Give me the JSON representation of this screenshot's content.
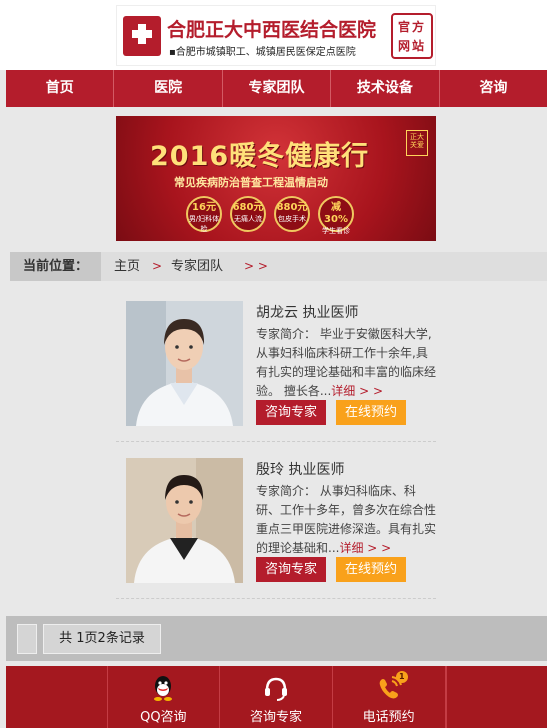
{
  "header": {
    "hospital_name": "合肥正大中西医结合医院",
    "tagline": "▪合肥市城镇职工、城镇居民医保定点医院",
    "badge_line1": "官方",
    "badge_line2": "网站"
  },
  "nav": {
    "items": [
      {
        "label": "首页"
      },
      {
        "label": "医院"
      },
      {
        "label": "专家团队"
      },
      {
        "label": "技术设备"
      },
      {
        "label": "咨询"
      }
    ]
  },
  "banner": {
    "title": "2016暖冬健康行",
    "subtitle": "常见疾病防治普查工程温情启动",
    "stamp": "正大 关爱",
    "offers": [
      {
        "value": "16元",
        "desc": "男/妇科体检"
      },
      {
        "value": "680元",
        "desc": "无痛人流"
      },
      {
        "value": "880元",
        "desc": "包皮手术"
      },
      {
        "value": "减30%",
        "desc": "学生看诊"
      }
    ]
  },
  "breadcrumb": {
    "label": "当前位置：",
    "home": "主页",
    "sep": ">",
    "current": "专家团队",
    "trail": "> >"
  },
  "doctors": [
    {
      "name": "胡龙云 执业医师",
      "intro": "专家简介： 毕业于安徽医科大学,从事妇科临床科研工作十余年,具有扎实的理论基础和丰富的临床经验。 擅长各...",
      "more": "详细 > >",
      "consult_label": "咨询专家",
      "book_label": "在线预约"
    },
    {
      "name": "殷玲 执业医师",
      "intro": "专家简介： 从事妇科临床、科研、工作十多年，曾多次在综合性重点三甲医院进修深造。具有扎实的理论基础和...",
      "more": "详细 > >",
      "consult_label": "咨询专家",
      "book_label": "在线预约"
    }
  ],
  "pagination": {
    "info": "共 1页2条记录"
  },
  "bottom_bar": {
    "items": [
      {
        "label": "QQ咨询",
        "icon": "qq-icon"
      },
      {
        "label": "咨询专家",
        "icon": "headset-icon"
      },
      {
        "label": "电话预约",
        "icon": "phone-icon",
        "badge": "1"
      }
    ]
  },
  "colors": {
    "brand_red": "#b41d2c",
    "accent_orange": "#f9a11b"
  }
}
